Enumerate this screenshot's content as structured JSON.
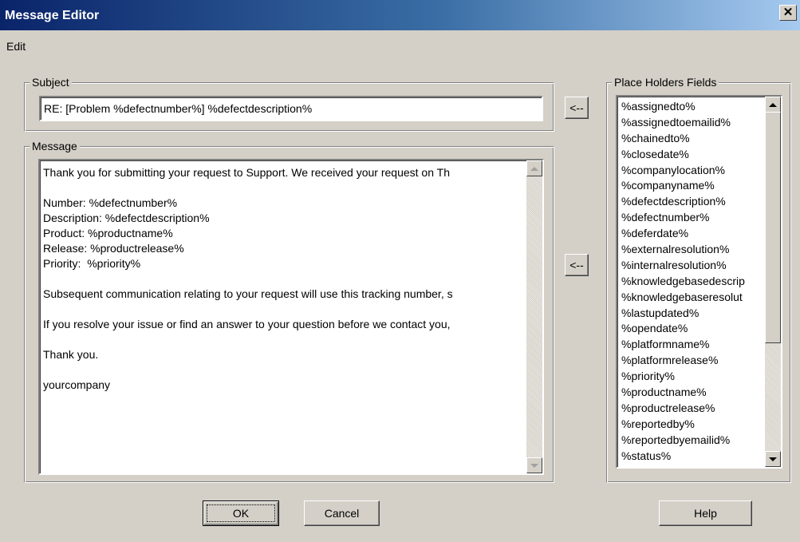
{
  "window": {
    "title": "Message Editor",
    "close_label": "✕"
  },
  "menu": {
    "edit": "Edit"
  },
  "subject": {
    "label": "Subject",
    "value": "RE: [Problem %defectnumber%] %defectdescription%"
  },
  "message": {
    "label": "Message",
    "lines": [
      "Thank you for submitting your request to Support. We received your request on Th",
      "",
      "Number: %defectnumber%",
      "Description: %defectdescription%",
      "Product: %productname%",
      "Release: %productrelease%",
      "Priority:  %priority%",
      "",
      "Subsequent communication relating to your request will use this tracking number, s",
      "",
      "If you resolve your issue or find an answer to your question before we contact you,",
      "",
      "Thank you.",
      "",
      "yourcompany"
    ]
  },
  "insert_buttons": {
    "subject": "<--",
    "message": "<--"
  },
  "placeholders": {
    "label": "Place Holders Fields",
    "items": [
      "%assignedto%",
      "%assignedtoemailid%",
      "%chainedto%",
      "%closedate%",
      "%companylocation%",
      "%companyname%",
      "%defectdescription%",
      "%defectnumber%",
      "%deferdate%",
      "%externalresolution%",
      "%internalresolution%",
      "%knowledgebasedescrip",
      "%knowledgebaseresolut",
      "%lastupdated%",
      "%opendate%",
      "%platformname%",
      "%platformrelease%",
      "%priority%",
      "%productname%",
      "%productrelease%",
      "%reportedby%",
      "%reportedbyemailid%",
      "%status%"
    ]
  },
  "buttons": {
    "ok": "OK",
    "cancel": "Cancel",
    "help": "Help"
  }
}
